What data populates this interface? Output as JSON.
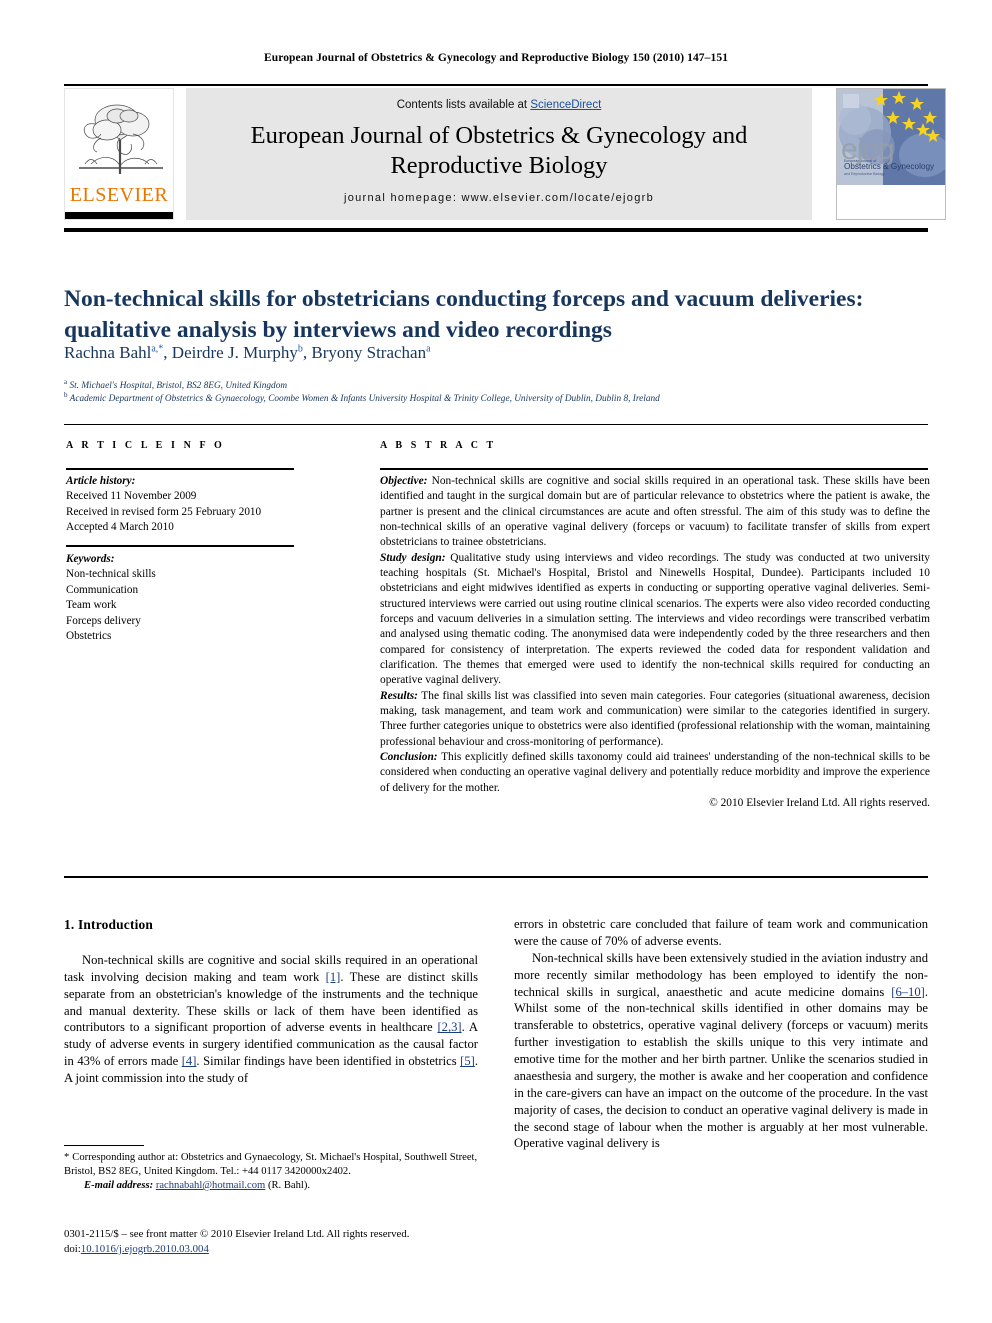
{
  "running_head": "European Journal of Obstetrics & Gynecology and Reproductive Biology 150 (2010) 147–151",
  "masthead": {
    "contents_prefix": "Contents lists available at ",
    "contents_link": "ScienceDirect",
    "journal_title_line1": "European Journal of Obstetrics & Gynecology and",
    "journal_title_line2": "Reproductive Biology",
    "homepage": "journal homepage: www.elsevier.com/locate/ejogrb",
    "publisher_logo_text": "ELSEVIER",
    "cover": {
      "wordmark": "ejog",
      "superline": "European Journal of",
      "name": "Obstetrics & Gynecology",
      "subline": "and Reproductive Biology"
    }
  },
  "article": {
    "title": "Non-technical skills for obstetricians conducting forceps and vacuum deliveries: qualitative analysis by interviews and video recordings",
    "authors_html": "Rachna Bahl<sup>a,*</sup>, Deirdre J. Murphy<sup>b</sup>, Bryony Strachan<sup>a</sup>",
    "affiliation_a": "St. Michael's Hospital, Bristol, BS2 8EG, United Kingdom",
    "affiliation_b": "Academic Department of Obstetrics & Gynaecology, Coombe Women & Infants University Hospital & Trinity College, University of Dublin, Dublin 8, Ireland"
  },
  "article_info": {
    "heading": "A R T I C L E   I N F O",
    "history_label": "Article history:",
    "history": [
      "Received 11 November 2009",
      "Received in revised form 25 February 2010",
      "Accepted 4 March 2010"
    ],
    "keywords_label": "Keywords:",
    "keywords": [
      "Non-technical skills",
      "Communication",
      "Team work",
      "Forceps delivery",
      "Obstetrics"
    ]
  },
  "abstract": {
    "heading": "A B S T R A C T",
    "objective_label": "Objective:",
    "objective_text": " Non-technical skills are cognitive and social skills required in an operational task. These skills have been identified and taught in the surgical domain but are of particular relevance to obstetrics where the patient is awake, the partner is present and the clinical circumstances are acute and often stressful. The aim of this study was to define the non-technical skills of an operative vaginal delivery (forceps or vacuum) to facilitate transfer of skills from expert obstetricians to trainee obstetricians.",
    "design_label": "Study design:",
    "design_text": " Qualitative study using interviews and video recordings. The study was conducted at two university teaching hospitals (St. Michael's Hospital, Bristol and Ninewells Hospital, Dundee). Participants included 10 obstetricians and eight midwives identified as experts in conducting or supporting operative vaginal deliveries. Semi-structured interviews were carried out using routine clinical scenarios. The experts were also video recorded conducting forceps and vacuum deliveries in a simulation setting. The interviews and video recordings were transcribed verbatim and analysed using thematic coding. The anonymised data were independently coded by the three researchers and then compared for consistency of interpretation. The experts reviewed the coded data for respondent validation and clarification. The themes that emerged were used to identify the non-technical skills required for conducting an operative vaginal delivery.",
    "results_label": "Results:",
    "results_text": " The final skills list was classified into seven main categories. Four categories (situational awareness, decision making, task management, and team work and communication) were similar to the categories identified in surgery. Three further categories unique to obstetrics were also identified (professional relationship with the woman, maintaining professional behaviour and cross-monitoring of performance).",
    "conclusion_label": "Conclusion:",
    "conclusion_text": " This explicitly defined skills taxonomy could aid trainees' understanding of the non-technical skills to be considered when conducting an operative vaginal delivery and potentially reduce morbidity and improve the experience of delivery for the mother.",
    "copyright": "© 2010 Elsevier Ireland Ltd. All rights reserved."
  },
  "body": {
    "section_heading": "1. Introduction",
    "left_para_1_a": "Non-technical skills are cognitive and social skills required in an operational task involving decision making and team work ",
    "left_ref_1": "[1]",
    "left_para_1_b": ". These are distinct skills separate from an obstetrician's knowledge of the instruments and the technique and manual dexterity. These skills or lack of them have been identified as contributors to a significant proportion of adverse events in healthcare ",
    "left_ref_2": "[2,3]",
    "left_para_1_c": ". A study of adverse events in surgery identified communication as the causal factor in 43% of errors made ",
    "left_ref_3": "[4]",
    "left_para_1_d": ". Similar findings have been identified in obstetrics ",
    "left_ref_4": "[5]",
    "left_para_1_e": ". A joint commission into the study of",
    "right_para_1": "errors in obstetric care concluded that failure of team work and communication were the cause of 70% of adverse events.",
    "right_para_2_a": "Non-technical skills have been extensively studied in the aviation industry and more recently similar methodology has been employed to identify the non-technical skills in surgical, anaesthetic and acute medicine domains ",
    "right_ref_1": "[6–10]",
    "right_para_2_b": ". Whilst some of the non-technical skills identified in other domains may be transferable to obstetrics, operative vaginal delivery (forceps or vacuum) merits further investigation to establish the skills unique to this very intimate and emotive time for the mother and her birth partner. Unlike the scenarios studied in anaesthesia and surgery, the mother is awake and her cooperation and confidence in the care-givers can have an impact on the outcome of the procedure. In the vast majority of cases, the decision to conduct an operative vaginal delivery is made in the second stage of labour when the mother is arguably at her most vulnerable. Operative vaginal delivery is"
  },
  "footnotes": {
    "corresponding_marker": "*",
    "corresponding_text": " Corresponding author at: Obstetrics and Gynaecology, St. Michael's Hospital, Southwell Street, Bristol, BS2 8EG, United Kingdom. Tel.: +44 0117 3420000x2402.",
    "email_label": "E-mail address:",
    "email": "rachnabahl@hotmail.com",
    "email_suffix": " (R. Bahl).",
    "frontmatter": "0301-2115/$ – see front matter © 2010 Elsevier Ireland Ltd. All rights reserved.",
    "doi_label": "doi:",
    "doi": "10.1016/j.ejogrb.2010.03.004"
  },
  "colors": {
    "link_blue": "#1a4f9c",
    "title_navy": "#17365d",
    "elsevier_orange": "#ea7600",
    "panel_grey": "#e6e6e6"
  }
}
